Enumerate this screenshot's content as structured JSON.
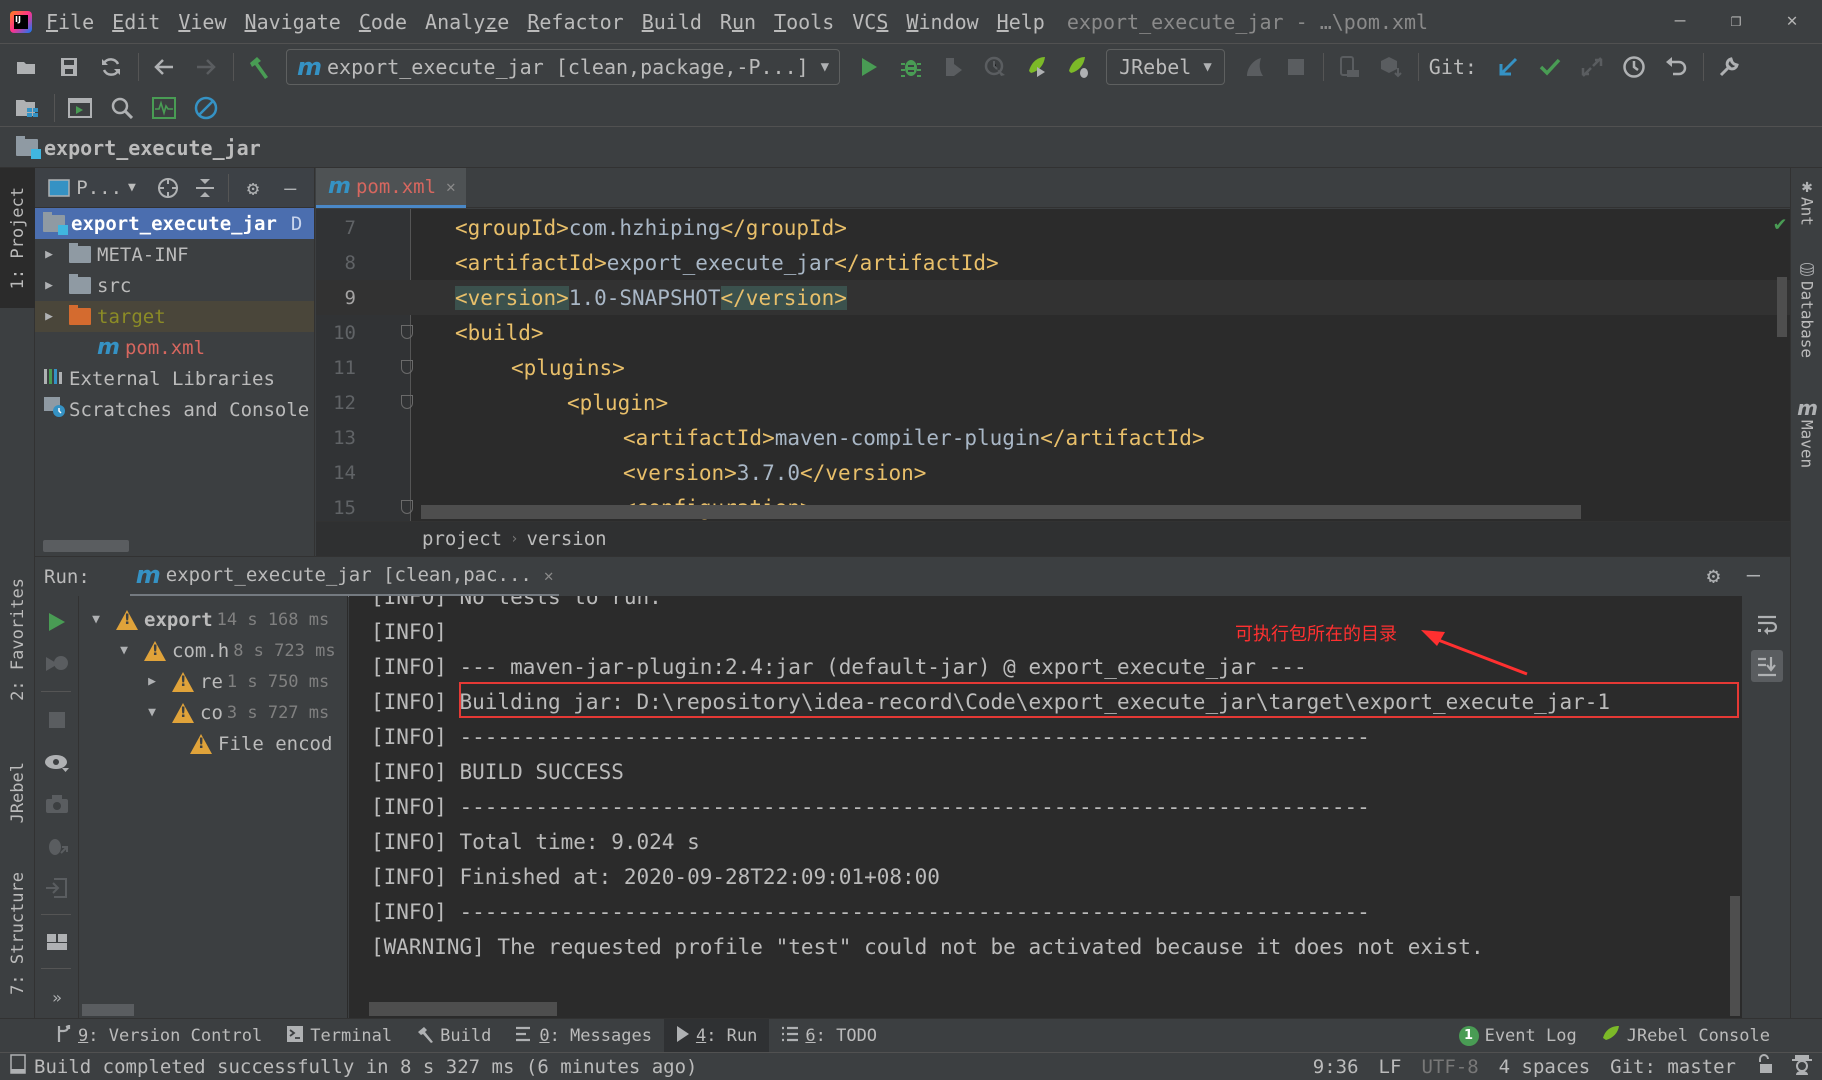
{
  "app": {
    "window_title": "export_execute_jar - …\\pom.xml",
    "menu": [
      "File",
      "Edit",
      "View",
      "Navigate",
      "Code",
      "Analyze",
      "Refactor",
      "Build",
      "Run",
      "Tools",
      "VCS",
      "Window",
      "Help"
    ],
    "menu_mnemonics": [
      "F",
      "E",
      "V",
      "N",
      "C",
      "z",
      "R",
      "B",
      "u",
      "T",
      "S",
      "W",
      "H"
    ],
    "window_controls": {
      "minimize": "—",
      "restore": "❐",
      "close": "✕"
    }
  },
  "toolbar": {
    "run_config": "export_execute_jar [clean,package,-P...]",
    "jrebel_config": "JRebel",
    "git_label": "Git:",
    "icons_row1": [
      "open-folder-icon",
      "save-all-icon",
      "sync-icon",
      "back-icon",
      "forward-icon",
      "build-hammer-icon",
      "run-icon",
      "debug-icon",
      "coverage-icon",
      "profile-icon",
      "jrebel-run-icon",
      "jrebel-debug-icon",
      "attach-icon",
      "stop-icon",
      "device-icon",
      "sdk-icon",
      "git-update-icon",
      "git-commit-icon",
      "git-merge-icon",
      "git-history-icon",
      "git-revert-icon",
      "settings-wrench-icon"
    ],
    "icons_row2": [
      "project-structure-icon",
      "run-dashboard-icon",
      "search-everywhere-icon",
      "monitor-icon",
      "power-save-icon"
    ]
  },
  "project_header": {
    "title": "export_execute_jar"
  },
  "left_strip": {
    "project_tab": "1: Project",
    "favorites_tab": "2: Favorites",
    "jrebel_tab": "JRebel",
    "structure_tab": "7: Structure"
  },
  "right_strip": {
    "ant_tab": "Ant",
    "database_tab": "Database",
    "maven_tab": "Maven"
  },
  "project_panel": {
    "view_selector": "P...",
    "tree": [
      {
        "label": "export_execute_jar",
        "suffix": "D",
        "type": "module",
        "selected": true,
        "depth": 0
      },
      {
        "label": "META-INF",
        "type": "folder",
        "depth": 1,
        "expandable": true
      },
      {
        "label": "src",
        "type": "folder",
        "depth": 1,
        "expandable": true
      },
      {
        "label": "target",
        "type": "excluded-folder",
        "depth": 1,
        "expandable": true
      },
      {
        "label": "pom.xml",
        "type": "maven-file",
        "depth": 1
      },
      {
        "label": "External Libraries",
        "type": "libraries",
        "depth": 0
      },
      {
        "label": "Scratches and Console",
        "type": "scratches",
        "depth": 0
      }
    ]
  },
  "editor": {
    "tab_label": "pom.xml",
    "current_line": 9,
    "lines": [
      {
        "n": "7",
        "indent": 1,
        "open": "<groupId>",
        "text": "com.hzhiping",
        "close": "</groupId>"
      },
      {
        "n": "8",
        "indent": 1,
        "open": "<artifactId>",
        "text": "export_execute_jar",
        "close": "</artifactId>"
      },
      {
        "n": "9",
        "indent": 1,
        "open": "<version>",
        "text": "1.0-SNAPSHOT",
        "close": "</version>"
      },
      {
        "n": "10",
        "indent": 1,
        "open": "<build>",
        "text": "",
        "close": ""
      },
      {
        "n": "11",
        "indent": 2,
        "open": "<plugins>",
        "text": "",
        "close": ""
      },
      {
        "n": "12",
        "indent": 3,
        "open": "<plugin>",
        "text": "",
        "close": ""
      },
      {
        "n": "13",
        "indent": 4,
        "open": "<artifactId>",
        "text": "maven-compiler-plugin",
        "close": "</artifactId>"
      },
      {
        "n": "14",
        "indent": 4,
        "open": "<version>",
        "text": "3.7.0",
        "close": "</version>"
      },
      {
        "n": "15",
        "indent": 4,
        "open": "<configuration>",
        "text": "",
        "close": ""
      }
    ],
    "breadcrumb": [
      "project",
      "version"
    ]
  },
  "run_panel": {
    "label": "Run:",
    "tab_label": "export_execute_jar [clean,pac...",
    "tree": [
      {
        "name": "export",
        "time": "14 s 168 ms",
        "depth": 0,
        "expanded": true,
        "bold": true
      },
      {
        "name": "com.h",
        "time": "8 s 723 ms",
        "depth": 1,
        "expanded": true
      },
      {
        "name": "re",
        "time": "1 s 750 ms",
        "depth": 2,
        "expanded": false
      },
      {
        "name": "co",
        "time": "3 s 727 ms",
        "depth": 2,
        "expanded": true
      },
      {
        "name": "File encod",
        "time": "",
        "depth": 3,
        "leaf": true
      }
    ],
    "console": [
      "[INFO] No tests to run.",
      "[INFO]",
      "[INFO] --- maven-jar-plugin:2.4:jar (default-jar) @ export_execute_jar ---",
      "[INFO] Building jar: D:\\repository\\idea-record\\Code\\export_execute_jar\\target\\export_execute_jar-1",
      "[INFO] ------------------------------------------------------------------------",
      "[INFO] BUILD SUCCESS",
      "[INFO] ------------------------------------------------------------------------",
      "[INFO] Total time: 9.024 s",
      "[INFO] Finished at: 2020-09-28T22:09:01+08:00",
      "[INFO] ------------------------------------------------------------------------",
      "[WARNING] The requested profile \"test\" could not be activated because it does not exist."
    ],
    "annotation": "可执行包所在的目录",
    "annotation_color": "#ff3030"
  },
  "bottom_tabs": [
    {
      "key": "9",
      "label": ": Version Control",
      "icon": "version-control-icon"
    },
    {
      "key": "",
      "label": "Terminal",
      "icon": "terminal-icon"
    },
    {
      "key": "",
      "label": "Build",
      "icon": "build-icon"
    },
    {
      "key": "0",
      "label": ": Messages",
      "icon": "messages-icon"
    },
    {
      "key": "4",
      "label": ": Run",
      "icon": "run-icon",
      "active": true
    },
    {
      "key": "6",
      "label": ": TODO",
      "icon": "todo-icon"
    }
  ],
  "bottom_right_tabs": {
    "event_log": "Event Log",
    "event_log_count": "1",
    "jrebel_console": "JRebel Console"
  },
  "status_bar": {
    "message": "Build completed successfully in 8 s 327 ms (6 minutes ago)",
    "position": "9:36",
    "line_separator": "LF",
    "encoding": "UTF-8",
    "indent": "4 spaces",
    "vcs_branch": "Git: master"
  },
  "colors": {
    "accent": "#4b6eaf",
    "tag": "#e8bf6a",
    "warning": "#e0a33a",
    "success": "#499c54",
    "annotation": "#ff3030",
    "file_modified": "#d7675f"
  }
}
